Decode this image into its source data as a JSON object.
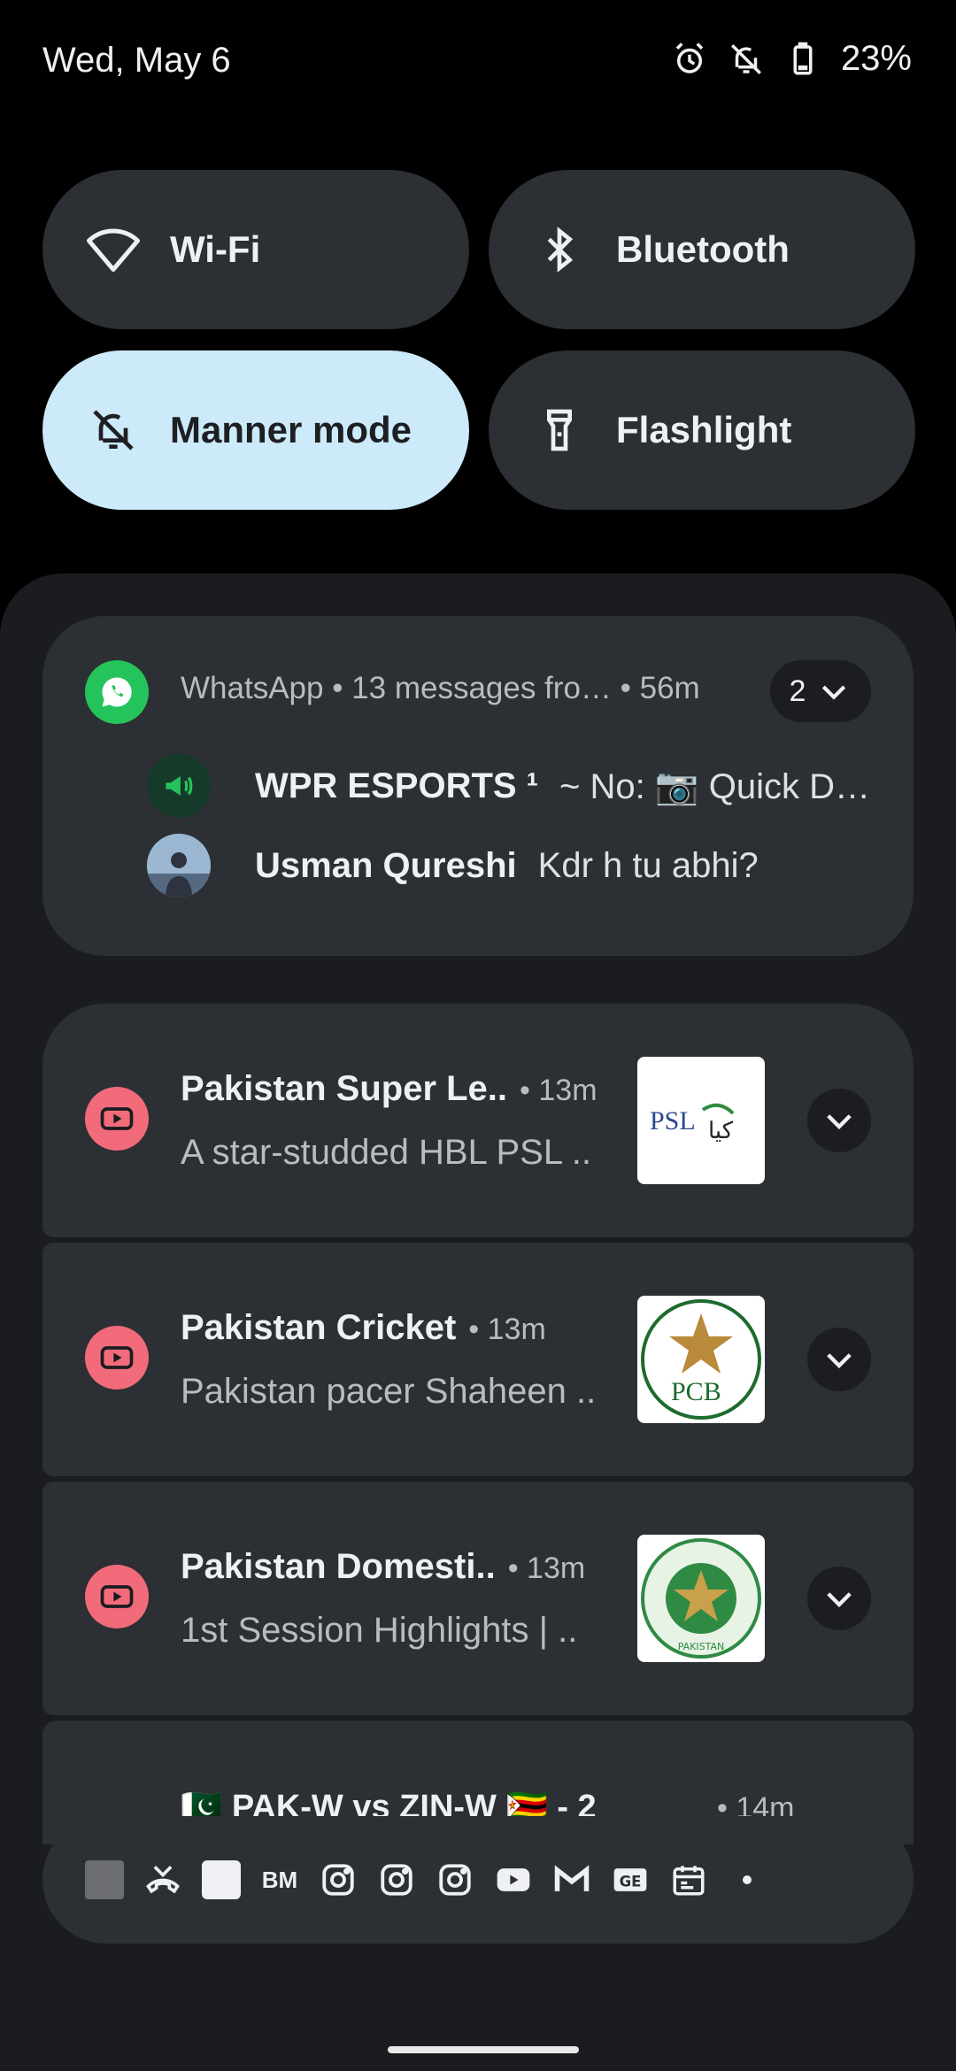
{
  "status_bar": {
    "date": "Wed, May 6",
    "battery": "23%"
  },
  "quick_settings": {
    "wifi": "Wi-Fi",
    "bluetooth": "Bluetooth",
    "manner": "Manner mode",
    "flashlight": "Flashlight"
  },
  "whatsapp": {
    "header": "WhatsApp • 13 messages fro… • 56m",
    "count": "2",
    "messages": [
      {
        "sender": "WPR ESPORTS ¹",
        "text": "~ No: 📷 Quick D…"
      },
      {
        "sender": "Usman Qureshi",
        "text": "Kdr h tu abhi?"
      }
    ]
  },
  "youtube": [
    {
      "title": "Pakistan Super Le..",
      "time": "• 13m",
      "body": "A star-studded HBL PSL ..",
      "thumb_label": "PSL"
    },
    {
      "title": "Pakistan Cricket",
      "time": "• 13m",
      "body": "Pakistan pacer Shaheen ..",
      "thumb_label": "PCB"
    },
    {
      "title": "Pakistan Domesti..",
      "time": "• 13m",
      "body": "1st Session Highlights | ..",
      "thumb_label": "PAKISTAN"
    }
  ],
  "peek": {
    "title": "🇵🇰 PAK-W vs ZIN-W 🇿🇼 - 2",
    "time": "• 14m"
  },
  "shelf": {
    "bm": "BM",
    "ge": "GE"
  },
  "colors": {
    "accent_tile": "#cdeafa",
    "card": "#2c2f33",
    "whatsapp_green": "#25c35b",
    "youtube_pink": "#f26b7a"
  }
}
